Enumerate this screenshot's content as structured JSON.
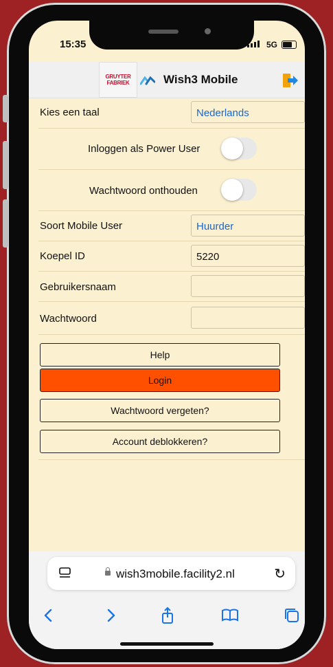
{
  "status_bar": {
    "time": "15:35",
    "network": "5G"
  },
  "header": {
    "logo_line1": "GRUYTER",
    "logo_line2": "FABRIEK",
    "title": "Wish3 Mobile",
    "logo_icon": "wish-logo-icon",
    "exit_icon": "exit-icon"
  },
  "form": {
    "language": {
      "label": "Kies een taal",
      "value": "Nederlands"
    },
    "power_user": {
      "label": "Inloggen als Power User",
      "on": false
    },
    "remember_password": {
      "label": "Wachtwoord onthouden",
      "on": false
    },
    "user_type": {
      "label": "Soort Mobile User",
      "value": "Huurder"
    },
    "koepel_id": {
      "label": "Koepel ID",
      "value": "5220"
    },
    "username": {
      "label": "Gebruikersnaam",
      "value": ""
    },
    "password": {
      "label": "Wachtwoord",
      "value": ""
    }
  },
  "buttons": {
    "help": "Help",
    "login": "Login",
    "forgot_password": "Wachtwoord vergeten?",
    "unblock_account": "Account deblokkeren?"
  },
  "browser": {
    "url": "wish3mobile.facility2.nl"
  },
  "colors": {
    "accent": "#ff5000",
    "background": "#fbf0d0",
    "link_blue": "#1a66cc",
    "frame": "#9e2224"
  }
}
